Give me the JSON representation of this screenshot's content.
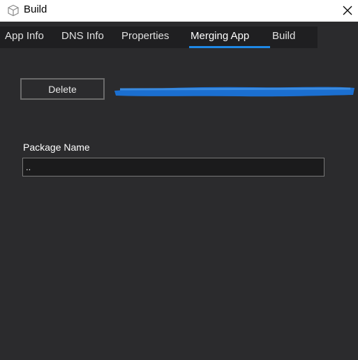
{
  "window": {
    "title": "Build",
    "close_icon": "close-icon",
    "app_icon": "cube-icon"
  },
  "tabs": [
    {
      "label": "App Info",
      "active": false
    },
    {
      "label": "DNS Info",
      "active": false
    },
    {
      "label": "Properties",
      "active": false
    },
    {
      "label": "Merging App",
      "active": true
    },
    {
      "label": "Build",
      "active": false
    }
  ],
  "toolbar": {
    "delete_label": "Delete"
  },
  "form": {
    "package_name_label": "Package Name",
    "package_name_value": ".."
  },
  "colors": {
    "background": "#2b2b2d",
    "tab_strip": "#1f1f21",
    "accent": "#1e88e5",
    "redaction": "#1b6fd0"
  }
}
